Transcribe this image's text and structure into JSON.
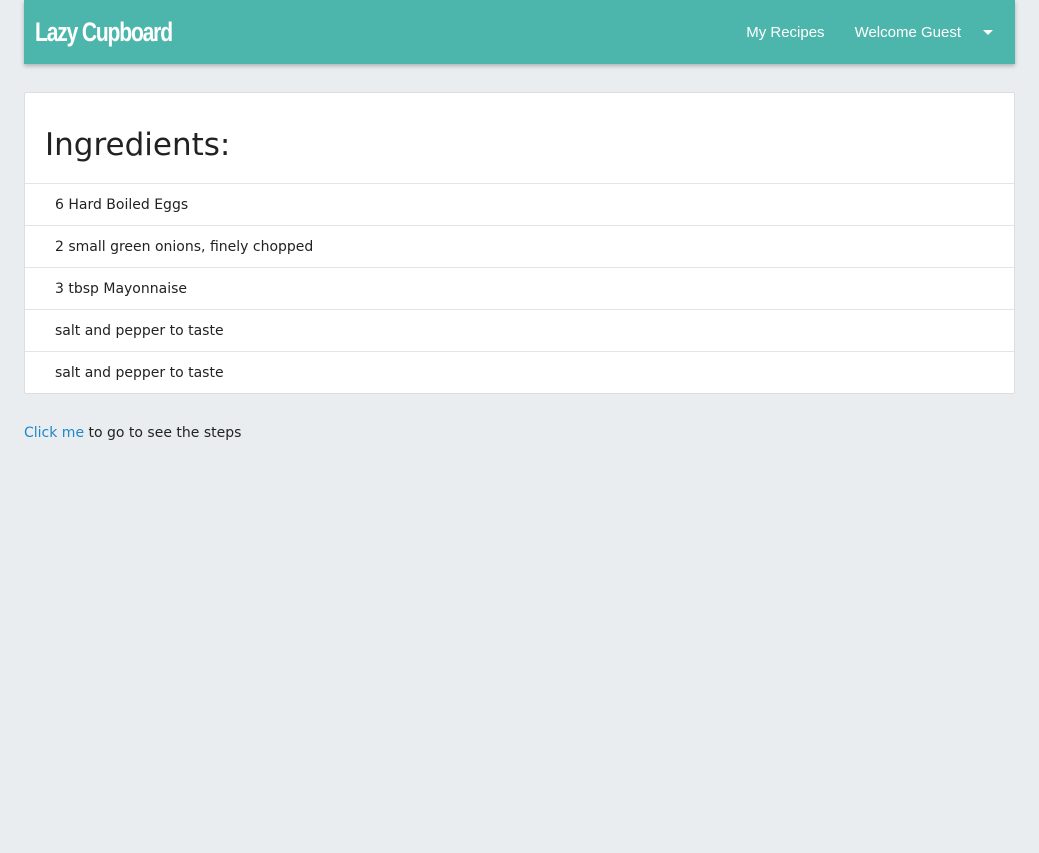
{
  "navbar": {
    "brand": "Lazy Cupboard",
    "my_recipes": "My Recipes",
    "welcome": "Welcome Guest",
    "background_color": "#4db6ac"
  },
  "ingredients": {
    "title": "Ingredients:",
    "items": [
      "6 Hard Boiled Eggs",
      "2 small green onions, finely chopped",
      "3 tbsp Mayonnaise",
      "salt and pepper to taste",
      "salt and pepper to taste"
    ]
  },
  "steps_link": {
    "link_text": "Click me",
    "rest_text": " to go to see the steps",
    "link_color": "#1e88c7"
  }
}
